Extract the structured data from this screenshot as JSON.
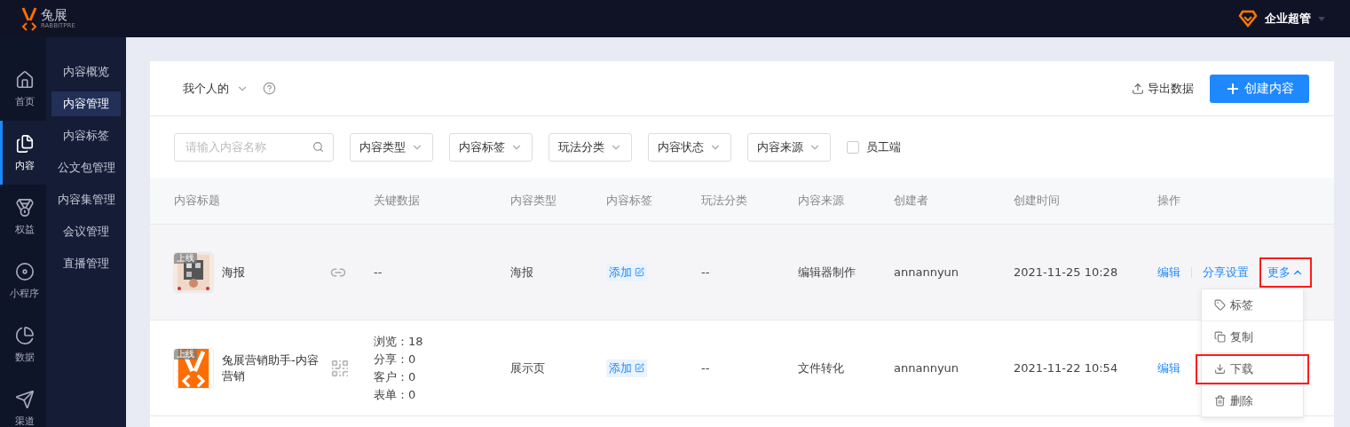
{
  "topbar": {
    "logo": "兔展",
    "logo_sub": "RABBITPRE",
    "user": "企业超管"
  },
  "rail": [
    {
      "label": "首页",
      "selected": false
    },
    {
      "label": "内容",
      "selected": true
    },
    {
      "label": "权益",
      "selected": false
    },
    {
      "label": "小程序",
      "selected": false
    },
    {
      "label": "数据",
      "selected": false
    },
    {
      "label": "渠道",
      "selected": false
    }
  ],
  "submenu": [
    {
      "label": "内容概览",
      "selected": false
    },
    {
      "label": "内容管理",
      "selected": true
    },
    {
      "label": "内容标签",
      "selected": false
    },
    {
      "label": "公文包管理",
      "selected": false
    },
    {
      "label": "内容集管理",
      "selected": false
    },
    {
      "label": "会议管理",
      "selected": false
    },
    {
      "label": "直播管理",
      "selected": false
    }
  ],
  "scope": "我个人的",
  "export": "导出数据",
  "create": "创建内容",
  "search": {
    "placeholder": "请输入内容名称"
  },
  "filters": [
    "内容类型",
    "内容标签",
    "玩法分类",
    "内容状态",
    "内容来源"
  ],
  "employee": {
    "label": "员工端",
    "checked": false
  },
  "table": {
    "columns": [
      "内容标题",
      "关键数据",
      "内容类型",
      "内容标签",
      "玩法分类",
      "内容来源",
      "创建者",
      "创建时间",
      "操作"
    ],
    "rows": [
      {
        "badge": "上线",
        "title": "海报",
        "stats": [
          "--"
        ],
        "type": "海报",
        "tag": "添加",
        "play": "--",
        "source": "编辑器制作",
        "creator": "annannyun",
        "time": "2021-11-25 10:28",
        "actions": [
          "编辑",
          "分享设置"
        ],
        "more": {
          "label": "更多",
          "expanded": true,
          "highlighted": true
        }
      },
      {
        "badge": "上线",
        "title": "兔展营销助手-内容营销",
        "stats": [
          "浏览：18",
          "分享：0",
          "客户：0",
          "表单：0"
        ],
        "type": "展示页",
        "tag": "添加",
        "play": "--",
        "source": "文件转化",
        "creator": "annannyun",
        "time": "2021-11-22 10:54",
        "actions": [
          "编辑"
        ]
      }
    ]
  },
  "menu": [
    {
      "label": "标签",
      "highlighted": false
    },
    {
      "label": "复制",
      "highlighted": false
    },
    {
      "label": "下载",
      "highlighted": true
    },
    {
      "label": "删除",
      "highlighted": false
    }
  ]
}
